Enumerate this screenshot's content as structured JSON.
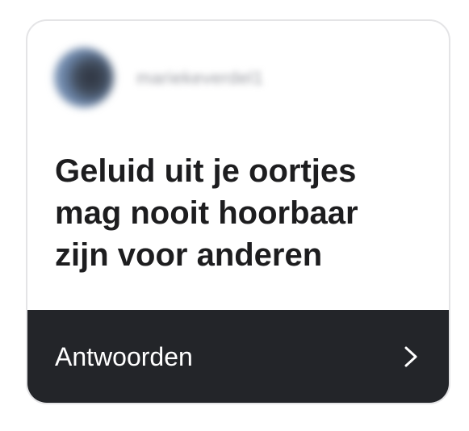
{
  "card": {
    "username": "mariekeverdel1",
    "question": "Geluid uit je oortjes\nmag nooit hoorbaar\nzijn voor anderen",
    "reply_label": "Antwoorden",
    "reply_icon": "chevron-right-icon"
  },
  "colors": {
    "card_background": "#ffffff",
    "footer_background": "#232529",
    "question_text": "#1d1d1f",
    "footer_text": "#ffffff"
  }
}
